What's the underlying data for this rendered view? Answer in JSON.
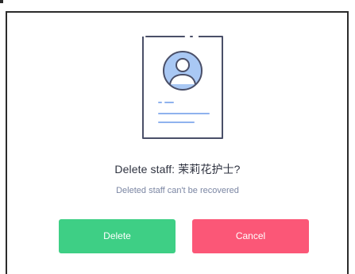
{
  "dialog": {
    "title": "Delete staff: 茉莉花护士?",
    "subtitle": "Deleted staff can't be recovered",
    "illustration_icon": "id-card-person-icon"
  },
  "actions": {
    "delete_label": "Delete",
    "cancel_label": "Cancel"
  },
  "colors": {
    "delete_button": "#3ecf85",
    "cancel_button": "#fb5777",
    "illustration_stroke": "#4a4f68",
    "avatar_fill": "#a9c8f4",
    "accent_lines": "#8fb2ee"
  }
}
